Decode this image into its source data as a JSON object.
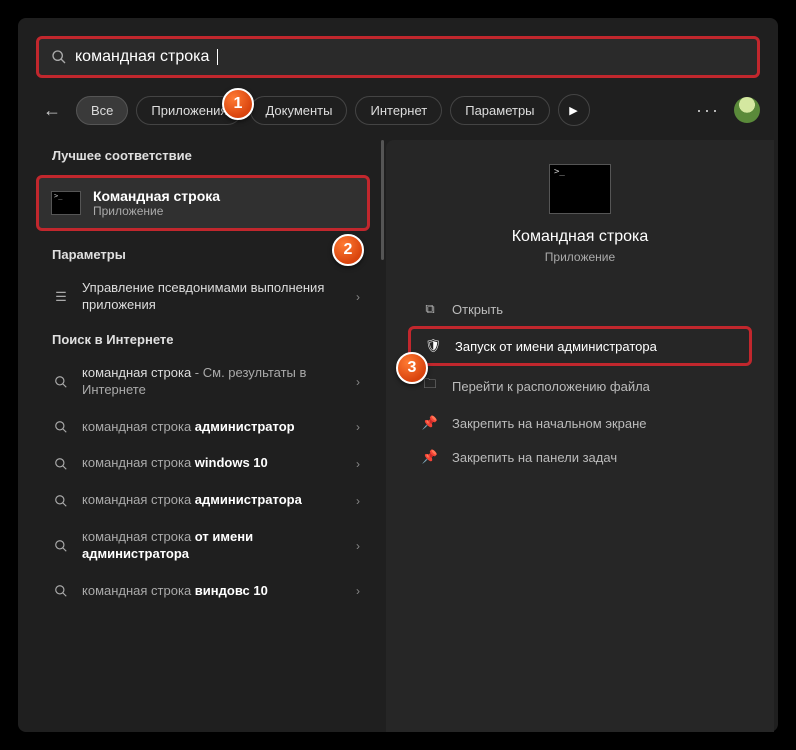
{
  "search": {
    "query": "командная строка"
  },
  "filters": {
    "items": [
      {
        "label": "Все",
        "active": true
      },
      {
        "label": "Приложения",
        "active": false
      },
      {
        "label": "Документы",
        "active": false
      },
      {
        "label": "Интернет",
        "active": false
      },
      {
        "label": "Параметры",
        "active": false
      }
    ]
  },
  "sections": {
    "best": "Лучшее соответствие",
    "settings": "Параметры",
    "web": "Поиск в Интернете"
  },
  "best_match": {
    "title": "Командная строка",
    "subtitle": "Приложение"
  },
  "settings_items": [
    {
      "label": "Управление псевдонимами выполнения приложения"
    }
  ],
  "web_items": [
    {
      "prefix": "командная строка",
      "suffix": " - См. результаты в Интернете"
    },
    {
      "prefix": "командная строка ",
      "bold": "администратор"
    },
    {
      "prefix": "командная строка ",
      "bold": "windows 10"
    },
    {
      "prefix": "командная строка ",
      "bold": "администратора"
    },
    {
      "prefix": "командная строка ",
      "bold": "от имени администратора"
    },
    {
      "prefix": "командная строка ",
      "bold": "виндовс 10"
    }
  ],
  "preview": {
    "title": "Командная строка",
    "subtitle": "Приложение",
    "actions": [
      {
        "icon": "open",
        "label": "Открыть",
        "highlight": false
      },
      {
        "icon": "admin",
        "label": "Запуск от имени администратора",
        "highlight": true
      },
      {
        "icon": "folder",
        "label": "Перейти к расположению файла",
        "highlight": false
      },
      {
        "icon": "pin",
        "label": "Закрепить на начальном экране",
        "highlight": false
      },
      {
        "icon": "pin",
        "label": "Закрепить на панели задач",
        "highlight": false
      }
    ]
  },
  "badges": [
    "1",
    "2",
    "3"
  ]
}
